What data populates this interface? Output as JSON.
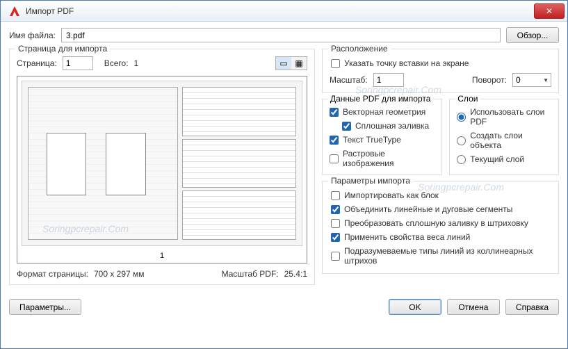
{
  "window": {
    "title": "Импорт PDF"
  },
  "file": {
    "label": "Имя файла:",
    "value": "3.pdf",
    "browse": "Обзор..."
  },
  "page_section": {
    "legend": "Страница для импорта",
    "page_label": "Страница:",
    "page_value": "1",
    "total_label": "Всего:",
    "total_value": "1",
    "preview_page": "1",
    "format_label": "Формат страницы:",
    "format_value": "700 x  297 мм",
    "scale_label": "Масштаб PDF:",
    "scale_value": "25.4:1"
  },
  "location": {
    "legend": "Расположение",
    "insert_point": "Указать точку вставки на экране",
    "scale_label": "Масштаб:",
    "scale_value": "1",
    "rotation_label": "Поворот:",
    "rotation_value": "0"
  },
  "pdf_data": {
    "legend": "Данные PDF для импорта",
    "vector": "Векторная геометрия",
    "solid": "Сплошная заливка",
    "truetype": "Текст TrueType",
    "raster": "Растровые изображения"
  },
  "layers": {
    "legend": "Слои",
    "use_pdf": "Использовать слои PDF",
    "create_obj": "Создать слои объекта",
    "current": "Текущий слой"
  },
  "import_params": {
    "legend": "Параметры импорта",
    "as_block": "Импортировать как блок",
    "join_segments": "Объединить линейные и дуговые сегменты",
    "convert_hatch": "Преобразовать сплошную заливку в штриховку",
    "lineweight": "Применить свойства веса линий",
    "infer_linetype": "Подразумеваемые типы линий из коллинеарных штрихов"
  },
  "footer": {
    "params": "Параметры...",
    "ok": "OK",
    "cancel": "Отмена",
    "help": "Справка"
  }
}
